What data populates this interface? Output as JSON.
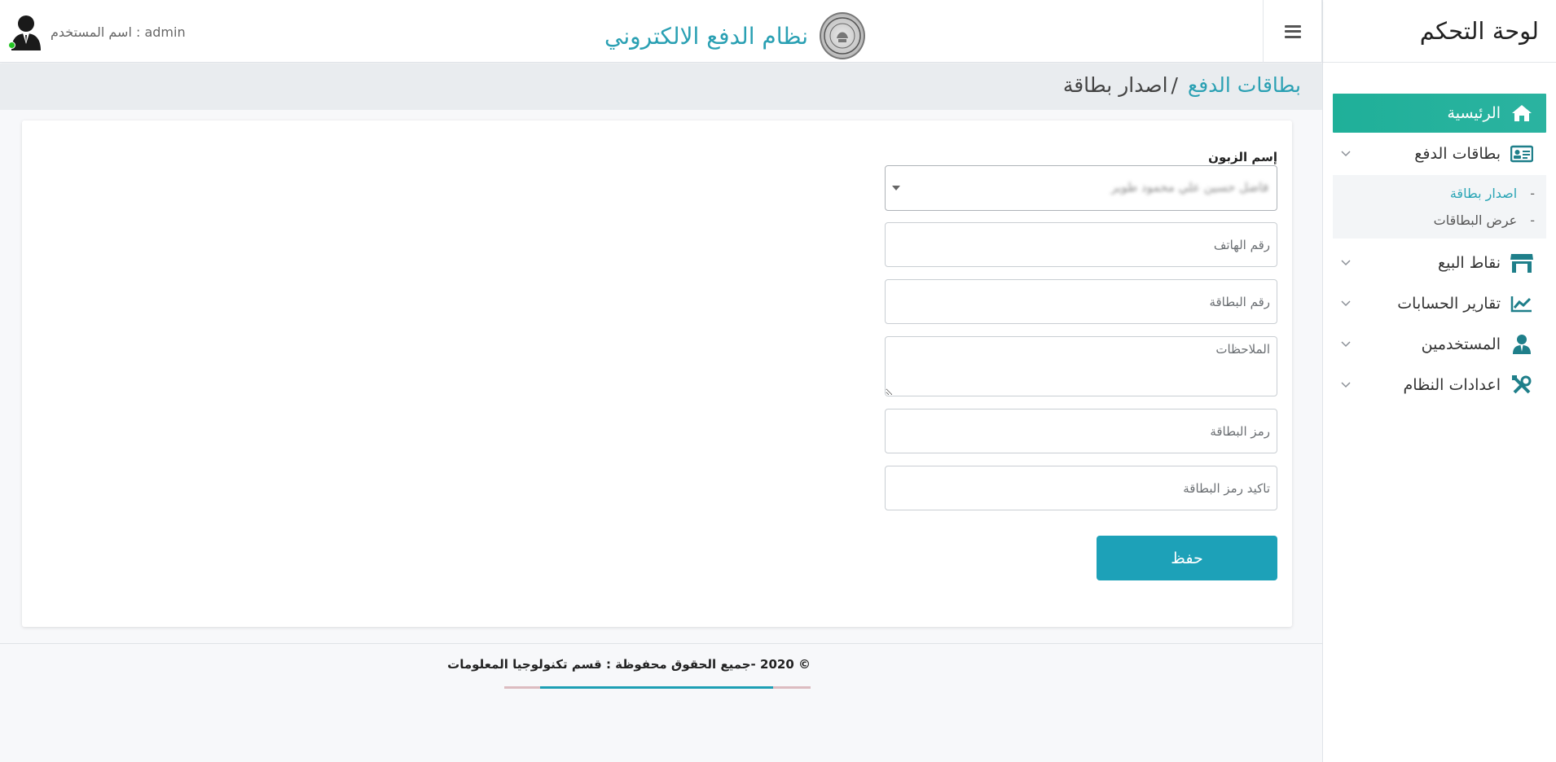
{
  "sidebar": {
    "title": "لوحة التحكم",
    "menu": [
      {
        "label": "الرئيسية",
        "icon": "home-icon",
        "active": true
      },
      {
        "label": "بطاقات الدفع",
        "icon": "id-card-icon",
        "active": false
      },
      {
        "label": "نقاط البيع",
        "icon": "store-icon",
        "active": false
      },
      {
        "label": "تقارير الحسابات",
        "icon": "chart-line-icon",
        "active": false
      },
      {
        "label": "المستخدمين",
        "icon": "user-tie-icon",
        "active": false
      },
      {
        "label": "اعدادات النظام",
        "icon": "tools-icon",
        "active": false
      }
    ],
    "submenu": [
      {
        "dash": "-",
        "label": "اصدار بطاقة",
        "current": true
      },
      {
        "dash": "-",
        "label": "عرض البطاقات",
        "current": false
      }
    ]
  },
  "topbar": {
    "app_title": "نظام الدفع الالكتروني",
    "user_label": "اسم المستخدم : admin",
    "menu_icon": "hamburger-icon",
    "logo_icon": "seal-logo"
  },
  "breadcrumb": {
    "parent": "بطاقات الدفع",
    "separator": "/",
    "current": "اصدار بطاقة"
  },
  "form": {
    "customer_label": "إسم الزبون",
    "customer_value": "فاضل حسين علي محمود طوير",
    "phone_placeholder": "رقم الهاتف",
    "card_number_placeholder": "رقم البطاقة",
    "notes_placeholder": "الملاحظات",
    "pin_placeholder": "رمز البطاقة",
    "pin_confirm_placeholder": "تاكيد رمز البطاقة",
    "save_label": "حفظ"
  },
  "footer": {
    "copyright": "© 2020 -جميع الحقوق محفوظة : قسم تكنولوجيا المعلومات"
  },
  "colors": {
    "accent": "#2aa0b3",
    "active_menu": "#1fb099",
    "button": "#1da1b8",
    "online_dot": "#22c322"
  }
}
